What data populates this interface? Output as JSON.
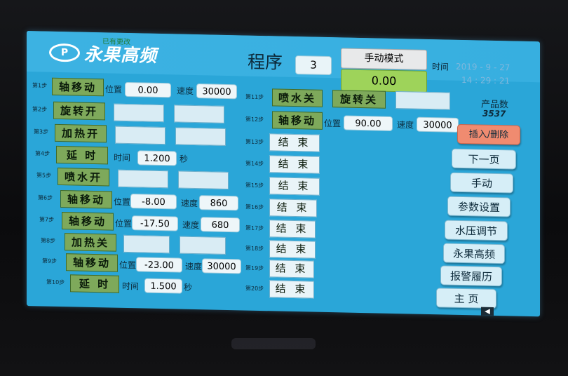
{
  "header": {
    "logo_text": "永果高频",
    "logo_mark": "P",
    "logo_sub": "已有更改",
    "program_label": "程序",
    "program_number": "3",
    "mode": "手动模式",
    "current_value": "0.00",
    "time_label": "时间",
    "date": "2019 - 9 - 27",
    "clock": "14 : 29 : 21"
  },
  "labels": {
    "position": "位置",
    "speed": "速度",
    "time": "时间",
    "seconds": "秒"
  },
  "steps": [
    {
      "label": "第1步",
      "action": "轴移动",
      "position": "0.00",
      "speed": "30000"
    },
    {
      "label": "第2步",
      "action": "旋转开"
    },
    {
      "label": "第3步",
      "action": "加热开"
    },
    {
      "label": "第4步",
      "action": "延 时",
      "time": "1.200"
    },
    {
      "label": "第5步",
      "action": "喷水开"
    },
    {
      "label": "第6步",
      "action": "轴移动",
      "position": "-8.00",
      "speed": "860"
    },
    {
      "label": "第7步",
      "action": "轴移动",
      "position": "-17.50",
      "speed": "680"
    },
    {
      "label": "第8步",
      "action": "加热关"
    },
    {
      "label": "第9步",
      "action": "轴移动",
      "position": "-23.00",
      "speed": "30000"
    },
    {
      "label": "第10步",
      "action": "延 时",
      "time": "1.500"
    },
    {
      "label": "第11步",
      "action": "喷水关",
      "action2": "旋转关"
    },
    {
      "label": "第12步",
      "action": "轴移动",
      "position": "90.00",
      "speed": "30000"
    },
    {
      "label": "第13步",
      "action": "结 束"
    },
    {
      "label": "第14步",
      "action": "结 束"
    },
    {
      "label": "第15步",
      "action": "结 束"
    },
    {
      "label": "第16步",
      "action": "结 束"
    },
    {
      "label": "第17步",
      "action": "结 束"
    },
    {
      "label": "第18步",
      "action": "结 束"
    },
    {
      "label": "第19步",
      "action": "结 束"
    },
    {
      "label": "第20步",
      "action": "结 束"
    }
  ],
  "product_count": {
    "label": "产品数",
    "value": "3537"
  },
  "buttons": {
    "insert_delete": "插入/删除",
    "next_page": "下一页",
    "manual": "手动",
    "params": "参数设置",
    "water_pressure": "水压调节",
    "brand": "永果高频",
    "alarm_history": "报警履历",
    "home": "主 页"
  },
  "colors": {
    "screen": "#2aa6d8",
    "action_green": "#7ea95b",
    "value_green": "#9ed35a",
    "insert_red": "#f08b70"
  }
}
